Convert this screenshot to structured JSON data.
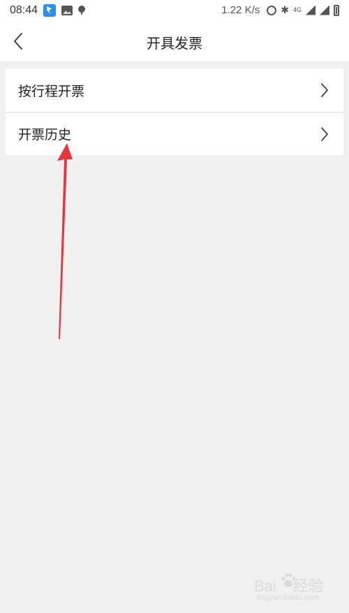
{
  "status_bar": {
    "time": "08:44",
    "net_speed": "1.22 K/s",
    "data_badge": "4G",
    "icons": [
      "feishu-app-icon",
      "gallery-icon",
      "location-pin-icon",
      "alarm-icon",
      "bluetooth-icon",
      "mobile-data-icon",
      "signal-icon",
      "signal-icon",
      "battery-icon"
    ]
  },
  "header": {
    "title": "开具发票",
    "back_icon": "chevron-left-icon"
  },
  "menu": {
    "items": [
      {
        "label": "按行程开票",
        "icon": "chevron-right-icon"
      },
      {
        "label": "开票历史",
        "icon": "chevron-right-icon"
      }
    ]
  },
  "annotation": {
    "arrow_color": "#e8343a"
  },
  "watermark": {
    "brand_left": "Bai",
    "brand_right": "经验",
    "sub": "jingyan.baidu.com"
  },
  "colors": {
    "background": "#f0f0f0",
    "surface": "#ffffff",
    "text": "#222222",
    "divider": "#dcdcdc"
  }
}
